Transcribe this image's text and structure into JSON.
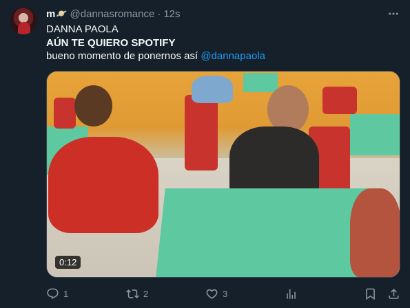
{
  "tweet": {
    "display_name": "m",
    "name_emoji": "🪐",
    "handle": "@dannasromance",
    "separator": "·",
    "time": "12s",
    "lines": [
      "DANNA PAOLA",
      "AÚN TE QUIERO SPOTIFY"
    ],
    "text_prefix": "bueno momento de ponernos así ",
    "mention": "@dannapaola"
  },
  "media": {
    "duration": "0:12"
  },
  "actions": {
    "replies": "1",
    "retweets": "2",
    "likes": "3"
  },
  "icons": {
    "more": "more-icon",
    "reply": "reply-icon",
    "retweet": "retweet-icon",
    "like": "heart-icon",
    "views": "views-icon",
    "bookmark": "bookmark-icon",
    "share": "share-icon"
  },
  "colors": {
    "background": "#15202b",
    "accent": "#1d9bf0",
    "secondary_text": "#8b98a5"
  }
}
